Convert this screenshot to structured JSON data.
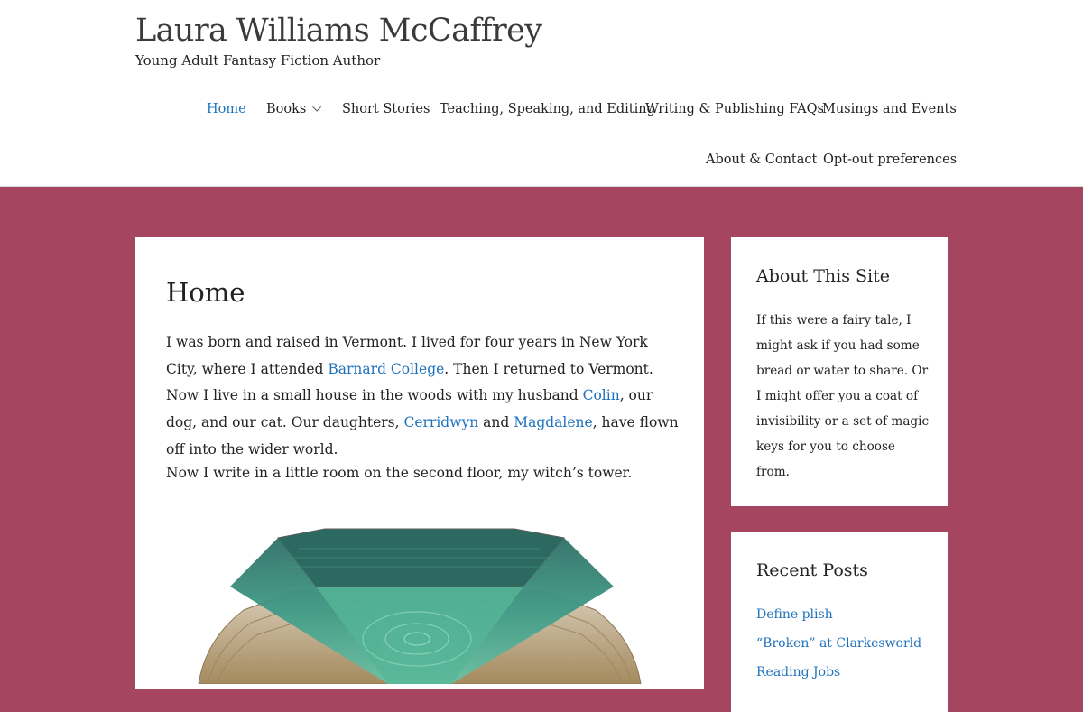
{
  "site": {
    "title": "Laura Williams McCaffrey",
    "tagline": "Young Adult Fantasy Fiction Author"
  },
  "nav": {
    "items": [
      {
        "label": "Home",
        "active": true
      },
      {
        "label": "Books",
        "has_submenu": true
      },
      {
        "label": "Short Stories"
      },
      {
        "label": "Teaching, Speaking, and Editing"
      },
      {
        "label": "Writing & Publishing FAQs"
      },
      {
        "label": "Musings and Events"
      },
      {
        "label": "About & Contact"
      },
      {
        "label": "Opt-out preferences"
      }
    ]
  },
  "main": {
    "title": "Home",
    "p1": {
      "t1": "I was born and raised in Vermont. I lived for four years in New York City, where I attended ",
      "link1": "Barnard College",
      "t2": ". Then I returned to Vermont. Now I live in a small house in the woods with my husband ",
      "link2": "Colin",
      "t3": ", our dog, and our cat. Our daughters, ",
      "link3": "Cerridwyn",
      "t4": " and ",
      "link4": "Magdalene",
      "t5": ", have flown off into the wider world."
    },
    "p2": "Now I write in a little room on the second floor, my witch’s tower."
  },
  "sidebar": {
    "about": {
      "title": "About This Site",
      "text": "If this were a fairy tale, I might ask if you had some bread or water to share. Or I might offer you a coat of invisibility or a set of magic keys for you to choose from."
    },
    "recent": {
      "title": "Recent Posts",
      "posts": [
        "Define plish",
        "“Broken” at Clarkesworld",
        "Reading Jobs"
      ]
    }
  },
  "colors": {
    "background": "#a6455f",
    "link": "#1e72bd",
    "card": "#ffffff"
  }
}
